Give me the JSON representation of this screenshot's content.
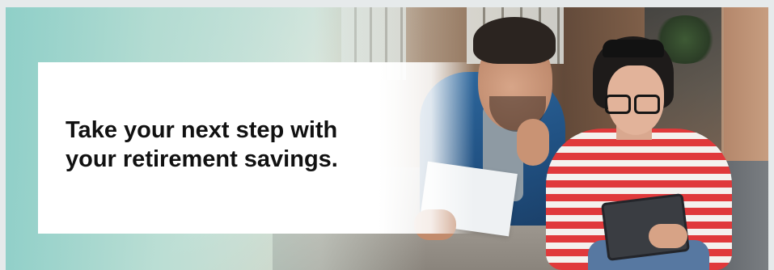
{
  "banner": {
    "headline_line1": "Take your next step with",
    "headline_line2": "your retirement savings.",
    "image_subject": "couple-reviewing-documents-on-sofa",
    "colors": {
      "teal_tint": "#8fcfc8",
      "headline_text": "#111111",
      "card_background": "#ffffff"
    }
  }
}
